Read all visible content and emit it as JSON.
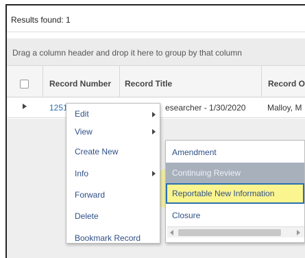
{
  "results": {
    "label": "Results found: 1"
  },
  "group_bar": {
    "hint": "Drag a column header and drop it here to group by that column"
  },
  "columns": {
    "record_number": "Record Number",
    "record_title": "Record Title",
    "record_o": "Record O"
  },
  "row": {
    "record_number": "12511",
    "record_title": "esearcher - 1/30/2020",
    "record_o": "Malloy, M"
  },
  "context_menu": {
    "items": [
      {
        "label": "Edit",
        "submenu": true
      },
      {
        "label": "View",
        "submenu": true
      },
      {
        "label": "Create New",
        "submenu": false
      },
      {
        "label": "Info",
        "submenu": true
      },
      {
        "label": "Forward",
        "submenu": false
      },
      {
        "label": "Delete",
        "submenu": false
      },
      {
        "label": "Bookmark Record",
        "submenu": false
      }
    ]
  },
  "submenu": {
    "items": [
      {
        "label": "Amendment",
        "state": "normal"
      },
      {
        "label": "Continuing Review",
        "state": "hover"
      },
      {
        "label": "Reportable New Information",
        "state": "selected"
      },
      {
        "label": "Closure",
        "state": "normal"
      }
    ]
  },
  "colors": {
    "link": "#2a6fb0",
    "menu_text": "#2f4f86",
    "highlight": "#fbf58f",
    "hover_bg": "#a8b0bc"
  }
}
